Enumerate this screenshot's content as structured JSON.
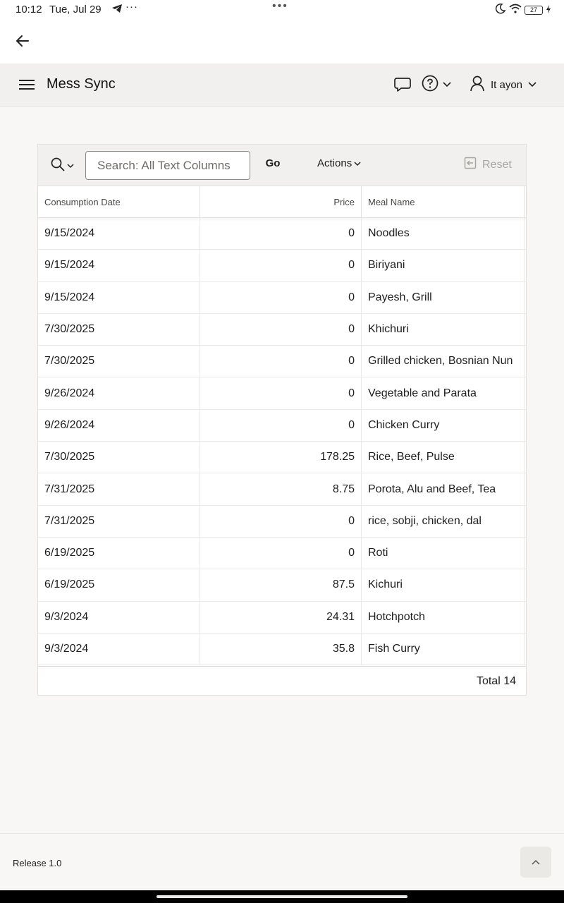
{
  "status_bar": {
    "time": "10:12",
    "date": "Tue, Jul 29",
    "more": "···",
    "center_dots": "•••",
    "battery": "27",
    "icons": [
      "telegram-icon",
      "moon-icon",
      "wifi-icon",
      "battery-icon",
      "charging-icon"
    ]
  },
  "nav": {
    "back_icon": "arrow-left-icon"
  },
  "header": {
    "title": "Mess Sync",
    "user_name": "It ayon",
    "icons": [
      "hamburger-icon",
      "chat-icon",
      "help-icon",
      "chevron-down-icon",
      "user-icon"
    ]
  },
  "toolbar": {
    "search_placeholder": "Search: All Text Columns",
    "search_value": "",
    "go_label": "Go",
    "actions_label": "Actions",
    "reset_label": "Reset"
  },
  "grid": {
    "columns": [
      "Consumption Date",
      "Price",
      "Meal Name"
    ],
    "rows": [
      [
        "9/15/2024",
        "0",
        "Noodles"
      ],
      [
        "9/15/2024",
        "0",
        "Biriyani"
      ],
      [
        "9/15/2024",
        "0",
        "Payesh, Grill"
      ],
      [
        "7/30/2025",
        "0",
        "Khichuri"
      ],
      [
        "7/30/2025",
        "0",
        "Grilled chicken, Bosnian Nun"
      ],
      [
        "9/26/2024",
        "0",
        "Vegetable and Parata"
      ],
      [
        "9/26/2024",
        "0",
        "Chicken Curry"
      ],
      [
        "7/30/2025",
        "178.25",
        "Rice, Beef, Pulse"
      ],
      [
        "7/31/2025",
        "8.75",
        "Porota, Alu and Beef, Tea"
      ],
      [
        "7/31/2025",
        "0",
        "rice, sobji, chicken, dal"
      ],
      [
        "6/19/2025",
        "0",
        "Roti"
      ],
      [
        "6/19/2025",
        "87.5",
        "Kichuri"
      ],
      [
        "9/3/2024",
        "24.31",
        "Hotchpotch"
      ],
      [
        "9/3/2024",
        "35.8",
        "Fish Curry"
      ]
    ],
    "total_label": "Total 14"
  },
  "footer": {
    "release": "Release 1.0",
    "top_icon": "chevron-up-icon"
  },
  "colors": {
    "header_bg": "#f1f0ee",
    "page_bg": "#f8f7f5",
    "battery_green": "#35b34a"
  }
}
